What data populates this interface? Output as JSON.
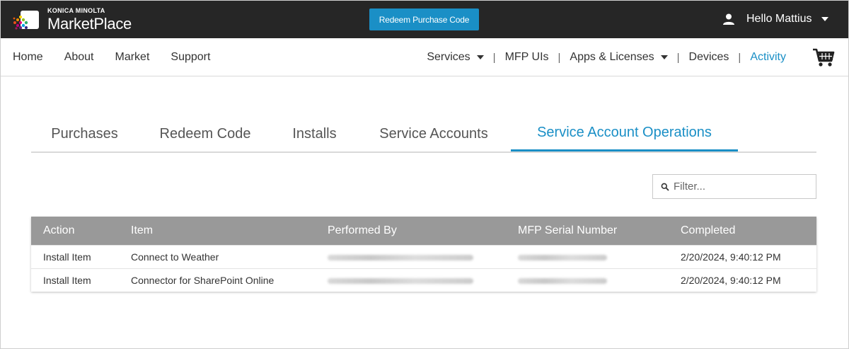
{
  "header": {
    "brand": "KONICA MINOLTA",
    "product": "MarketPlace",
    "redeem_button": "Redeem Purchase Code",
    "greeting": "Hello Mattius"
  },
  "nav": {
    "left": [
      "Home",
      "About",
      "Market",
      "Support"
    ],
    "right": [
      {
        "label": "Services",
        "dropdown": true
      },
      {
        "label": "MFP UIs",
        "dropdown": false
      },
      {
        "label": "Apps & Licenses",
        "dropdown": true
      },
      {
        "label": "Devices",
        "dropdown": false
      },
      {
        "label": "Activity",
        "dropdown": false,
        "active": true
      }
    ],
    "separator": "|"
  },
  "tabs": [
    {
      "label": "Purchases"
    },
    {
      "label": "Redeem Code"
    },
    {
      "label": "Installs"
    },
    {
      "label": "Service Accounts"
    },
    {
      "label": "Service Account Operations",
      "active": true
    }
  ],
  "filter": {
    "placeholder": "Filter..."
  },
  "table": {
    "columns": [
      "Action",
      "Item",
      "Performed By",
      "MFP Serial Number",
      "Completed"
    ],
    "rows": [
      {
        "action": "Install Item",
        "item": "Connect to Weather",
        "performed_by": "[redacted]",
        "serial": "[redacted]",
        "completed": "2/20/2024, 9:40:12 PM"
      },
      {
        "action": "Install Item",
        "item": "Connector for SharePoint Online",
        "performed_by": "[redacted]",
        "serial": "[redacted]",
        "completed": "2/20/2024, 9:40:12 PM"
      }
    ]
  },
  "colors": {
    "accent": "#1a8fc6",
    "topbar": "#262626",
    "table_header": "#999999"
  }
}
